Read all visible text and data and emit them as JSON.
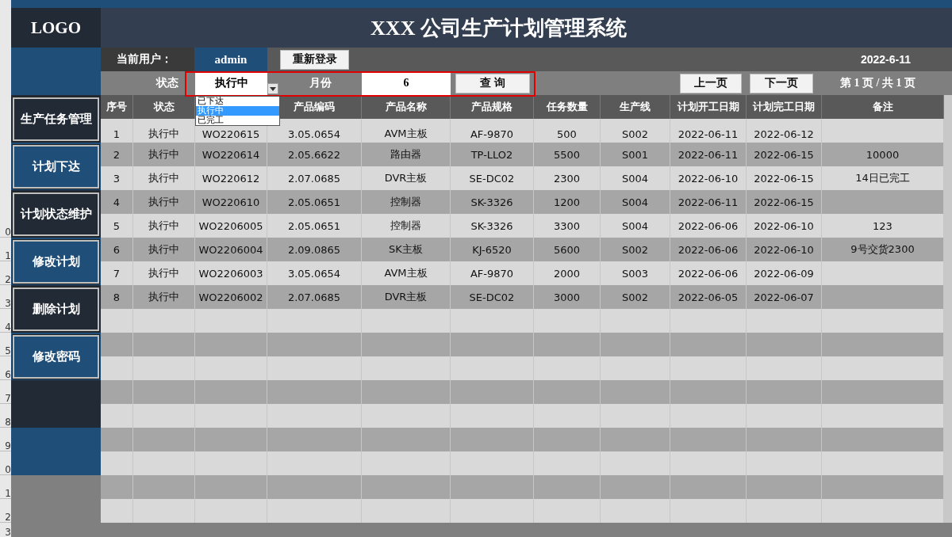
{
  "excel_row_headers": [
    "0",
    "1",
    "2",
    "3",
    "4",
    "5",
    "6",
    "7",
    "8",
    "9",
    "0",
    "1",
    "2",
    "3"
  ],
  "logo": "LOGO",
  "title": "XXX 公司生产计划管理系统",
  "user": {
    "label": "当前用户：",
    "name": "admin",
    "relogin_button": "重新登录",
    "date": "2022-6-11"
  },
  "filter": {
    "status_label": "状态",
    "status_value": "执行中",
    "status_options": [
      {
        "label": "已下达",
        "selected": false
      },
      {
        "label": "执行中",
        "selected": true
      },
      {
        "label": "已完工",
        "selected": false
      }
    ],
    "month_label": "月份",
    "month_value": "6",
    "query_button": "查 询"
  },
  "pager": {
    "prev_button": "上一页",
    "next_button": "下一页",
    "info": "第 1 页 / 共 1 页"
  },
  "sidebar": {
    "items": [
      {
        "label": "生产任务管理"
      },
      {
        "label": "计划下达"
      },
      {
        "label": "计划状态维护"
      },
      {
        "label": "修改计划"
      },
      {
        "label": "删除计划"
      },
      {
        "label": "修改密码"
      }
    ]
  },
  "table": {
    "columns": [
      "序号",
      "状态",
      null,
      "产品编码",
      "产品名称",
      "产品规格",
      "任务数量",
      "生产线",
      "计划开工日期",
      "计划完工日期",
      "备注"
    ],
    "rows": [
      [
        "1",
        "执行中",
        "WO220615",
        "3.05.0654",
        "AVM主板",
        "AF-9870",
        "500",
        "S002",
        "2022-06-11",
        "2022-06-12",
        null
      ],
      [
        "2",
        "执行中",
        "WO220614",
        "2.05.6622",
        "路由器",
        "TP-LLO2",
        "5500",
        "S001",
        "2022-06-11",
        "2022-06-15",
        "10000"
      ],
      [
        "3",
        "执行中",
        "WO220612",
        "2.07.0685",
        "DVR主板",
        "SE-DC02",
        "2300",
        "S004",
        "2022-06-10",
        "2022-06-15",
        "14日已完工"
      ],
      [
        "4",
        "执行中",
        "WO220610",
        "2.05.0651",
        "控制器",
        "SK-3326",
        "1200",
        "S004",
        "2022-06-11",
        "2022-06-15",
        null
      ],
      [
        "5",
        "执行中",
        "WO2206005",
        "2.05.0651",
        "控制器",
        "SK-3326",
        "3300",
        "S004",
        "2022-06-06",
        "2022-06-10",
        "123"
      ],
      [
        "6",
        "执行中",
        "WO2206004",
        "2.09.0865",
        "SK主板",
        "KJ-6520",
        "5600",
        "S002",
        "2022-06-06",
        "2022-06-10",
        "9号交货2300"
      ],
      [
        "7",
        "执行中",
        "WO2206003",
        "3.05.0654",
        "AVM主板",
        "AF-9870",
        "2000",
        "S003",
        "2022-06-06",
        "2022-06-09",
        null
      ],
      [
        "8",
        "执行中",
        "WO2206002",
        "2.07.0685",
        "DVR主板",
        "SE-DC02",
        "3000",
        "S002",
        "2022-06-05",
        "2022-06-07",
        null
      ]
    ]
  }
}
